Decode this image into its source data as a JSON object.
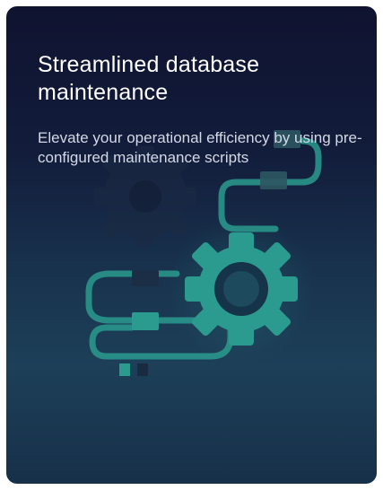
{
  "card": {
    "title": "Streamlined database maintenance",
    "description": "Elevate your operational efficiency by using pre-configured maintenance scripts",
    "illustration_icon": "gears-and-cables-illustration"
  },
  "colors": {
    "accent": "#2a9b8e",
    "background_top": "#0f1330",
    "background_bottom": "#1d3f58"
  }
}
